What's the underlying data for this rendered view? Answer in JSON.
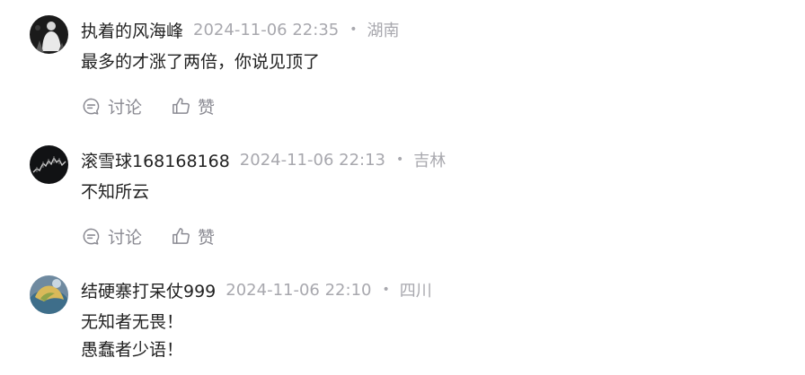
{
  "comments": [
    {
      "author": "执着的风海峰",
      "time": "2024-11-06 22:35",
      "region": "湖南",
      "lines": [
        "最多的才涨了两倍，你说见顶了"
      ],
      "discuss_label": "讨论",
      "like_label": "赞"
    },
    {
      "author": "滚雪球168168168",
      "time": "2024-11-06 22:13",
      "region": "吉林",
      "lines": [
        "不知所云"
      ],
      "discuss_label": "讨论",
      "like_label": "赞"
    },
    {
      "author": "结硬寨打呆仗999",
      "time": "2024-11-06 22:10",
      "region": "四川",
      "lines": [
        "无知者无畏！",
        "愚蠢者少语！"
      ]
    }
  ],
  "separator": "•",
  "colors": {
    "text": "#222222",
    "meta": "#a8a8ae",
    "action": "#8a8a92"
  },
  "icons": [
    "comment-bubble-icon",
    "thumbs-up-icon"
  ]
}
